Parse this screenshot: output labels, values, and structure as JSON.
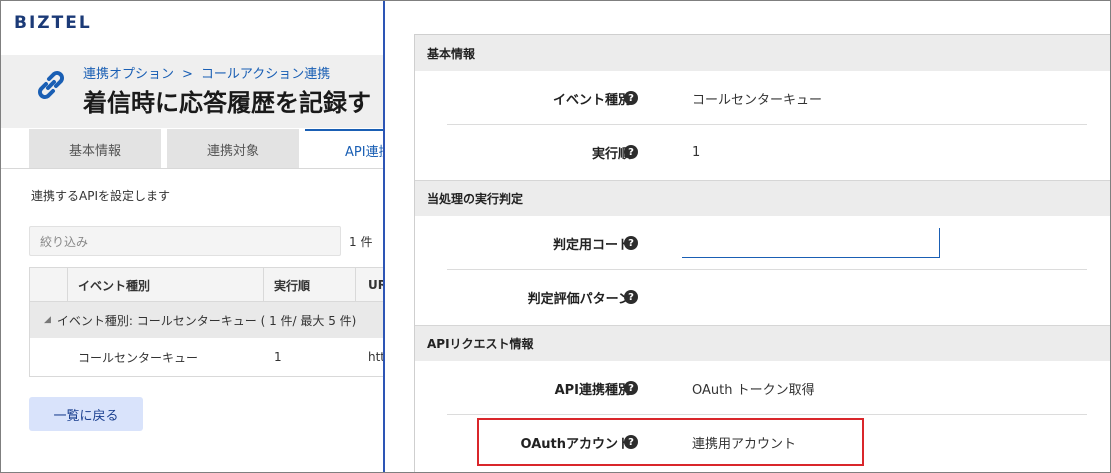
{
  "app": {
    "logo": "BIZTEL"
  },
  "header": {
    "breadcrumb_parent": "連携オプション",
    "breadcrumb_separator": ">",
    "breadcrumb_current": "コールアクション連携",
    "page_title": "着信時に応答履歴を記録す"
  },
  "tabs": [
    {
      "label": "基本情報",
      "active": false
    },
    {
      "label": "連携対象",
      "active": false
    },
    {
      "label": "API連携",
      "active": true
    }
  ],
  "list_view": {
    "description": "連携するAPIを設定します",
    "filter_placeholder": "絞り込み",
    "count_label": "1 件",
    "columns": [
      "イベント種別",
      "実行順",
      "UR"
    ],
    "group_row": "イベント種別: コールセンターキュー ( 1 件/ 最大 5 件)",
    "rows": [
      {
        "event_type": "コールセンターキュー",
        "order": "1",
        "url": "htt"
      }
    ],
    "back_button": "一覧に戻る"
  },
  "detail": {
    "sections": [
      {
        "title": "基本情報",
        "fields": [
          {
            "label": "イベント種別",
            "value": "コールセンターキュー"
          },
          {
            "label": "実行順",
            "value": "1"
          }
        ]
      },
      {
        "title": "当処理の実行判定",
        "fields": [
          {
            "label": "判定用コード",
            "value": ""
          },
          {
            "label": "判定評価パターン",
            "value": ""
          }
        ]
      },
      {
        "title": "APIリクエスト情報",
        "fields": [
          {
            "label": "API連携種別",
            "value": "OAuth トークン取得"
          },
          {
            "label": "OAuthアカウント",
            "value": "連携用アカウント"
          }
        ]
      }
    ],
    "help_glyph": "?"
  },
  "colors": {
    "accent": "#1a5fb4",
    "logo": "#1b3a77",
    "divider": "#2d55b5",
    "highlight": "#d9262b"
  },
  "icons": {
    "page_icon": "link-icon",
    "help_icon": "question-icon",
    "group_toggle": "caret-down-icon"
  }
}
